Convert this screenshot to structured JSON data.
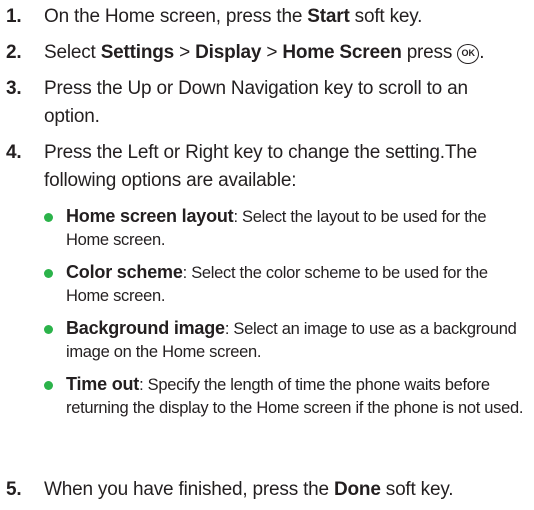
{
  "steps": [
    {
      "number": "1.",
      "parts": [
        "On the Home screen, press the ",
        "Start",
        " soft key."
      ]
    },
    {
      "number": "2.",
      "parts": [
        "Select ",
        "Settings",
        " > ",
        "Display",
        " > ",
        "Home Screen",
        " press "
      ],
      "icon": "ok-key-icon",
      "icon_label": "OK"
    },
    {
      "number": "3.",
      "text": "Press the Up or Down Navigation key to scroll to an option."
    },
    {
      "number": "4.",
      "text": "Press the Left or Right key to change the setting.The following options are available:"
    },
    {
      "number": "5.",
      "parts": [
        "When you have finished, press the ",
        "Done",
        " soft key."
      ]
    }
  ],
  "options": [
    {
      "term": "Home screen layout",
      "description": ": Select the layout to be used for the Home screen."
    },
    {
      "term": "Color scheme",
      "description": ": Select the color scheme to be used for the Home screen."
    },
    {
      "term": "Background image",
      "description": ": Select an image to use as a background image on the Home screen."
    },
    {
      "term": "Time out",
      "description": ": Specify the length of time the phone waits before returning the display to the Home screen if the phone is not used."
    }
  ],
  "colors": {
    "text": "#231f20",
    "bullet": "#2bb34a"
  }
}
